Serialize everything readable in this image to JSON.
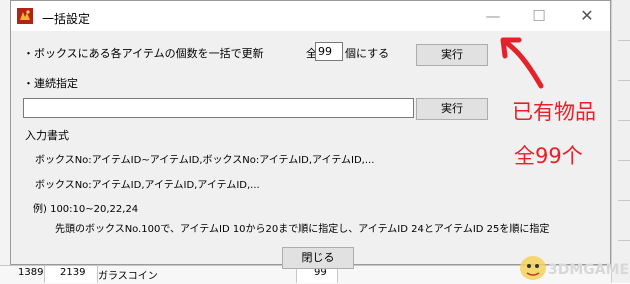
{
  "dialog": {
    "title": "一括設定",
    "bulk_label": "・ボックスにある各アイテムの個数を一括で更新",
    "all_label": "全",
    "count_value": "99",
    "set_suffix": "個にする",
    "execute_label": "実行",
    "continuous_label": "・連続指定",
    "continuous_value": "",
    "execute2_label": "実行",
    "format_heading": "入力書式",
    "format_line1": "ボックスNo:アイテムID~アイテムID,ボックスNo:アイテムID,アイテムID,...",
    "format_line2": "ボックスNo:アイテムID,アイテムID,アイテムID,...",
    "example_line": "例) 100:10~20,22,24",
    "example_desc": "先頭のボックスNo.100で、アイテムID 10から20まで順に指定し、アイテムID 24とアイテムID 25を順に指定",
    "close_label": "閉じる",
    "window_buttons": {
      "minimize": "—",
      "maximize": "☐",
      "close": "✕"
    }
  },
  "background": {
    "row_cells": [
      "1389",
      "2139",
      "ガラスコイン",
      "99"
    ]
  },
  "annotation": {
    "line1": "已有物品",
    "line2": "全99个",
    "color": "#e5212a"
  },
  "watermark": {
    "text": "3DMGAME"
  }
}
